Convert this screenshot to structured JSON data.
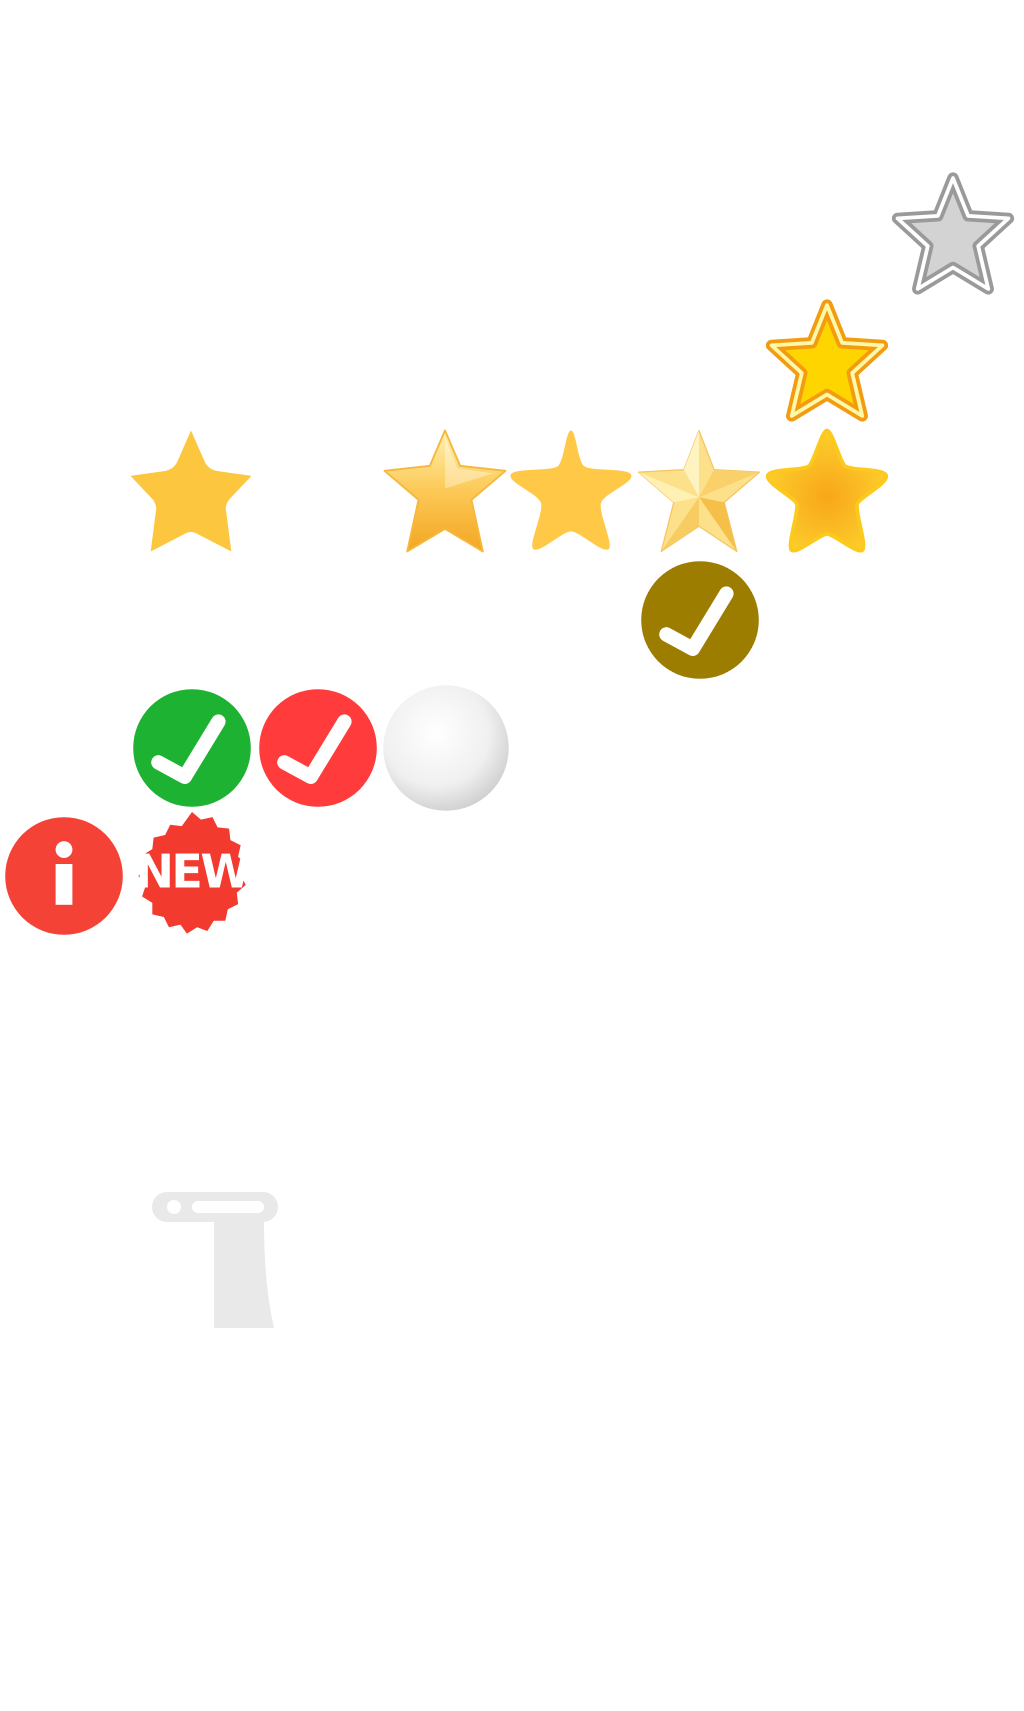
{
  "sprites": [
    {
      "name": "star-gray-outline-icon",
      "kind": "star-outline",
      "fill": "#d3d3d3",
      "stroke": "#9a9a9a"
    },
    {
      "name": "star-yellow-outline-icon",
      "kind": "star-outline",
      "fill": "#ffd500",
      "stroke": "#f39c12"
    },
    {
      "name": "star-flat-gold-icon",
      "kind": "star-flat",
      "fill": "#fcc73e"
    },
    {
      "name": "star-glossy-gold-icon",
      "kind": "star-glossy",
      "fill": "#fbc74a"
    },
    {
      "name": "star-rounded-gold-icon",
      "kind": "star-rounded",
      "fill": "#ffc947"
    },
    {
      "name": "star-faceted-gold-icon",
      "kind": "star-faceted",
      "fill": "#fde08a"
    },
    {
      "name": "star-orange-gold-icon",
      "kind": "star-orange",
      "fill": "#fcb714"
    },
    {
      "name": "check-badge-olive-icon",
      "kind": "check",
      "fill": "#9c7d00"
    },
    {
      "name": "check-badge-green-icon",
      "kind": "check",
      "fill": "#1db232"
    },
    {
      "name": "check-badge-red-icon",
      "kind": "check",
      "fill": "#ff3b3b"
    },
    {
      "name": "white-ball-icon",
      "kind": "ball",
      "fill": "#f1f1f1"
    },
    {
      "name": "info-badge-icon",
      "kind": "info",
      "fill": "#f44336"
    },
    {
      "name": "new-badge-icon",
      "kind": "new",
      "fill": "#f23a2f",
      "label": "NEW"
    },
    {
      "name": "pillar-icon",
      "kind": "pillar",
      "fill": "#e9e9e9"
    }
  ]
}
